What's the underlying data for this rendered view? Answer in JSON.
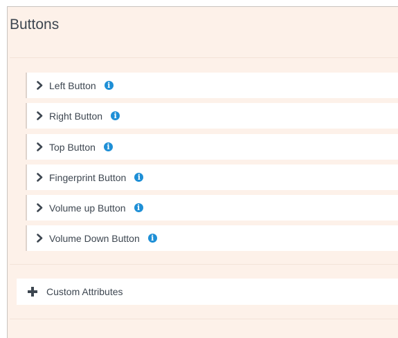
{
  "panel": {
    "title": "Buttons"
  },
  "accordion": {
    "items": [
      {
        "label": "Left Button",
        "icon": "info-icon"
      },
      {
        "label": "Right Button",
        "icon": "info-icon"
      },
      {
        "label": "Top Button",
        "icon": "info-icon"
      },
      {
        "label": "Fingerprint Button",
        "icon": "info-icon"
      },
      {
        "label": "Volume up Button",
        "icon": "info-icon"
      },
      {
        "label": "Volume Down Button",
        "icon": "info-icon"
      }
    ],
    "expand_icon": "chevron-right-icon",
    "info_glyph": "i"
  },
  "custom_attributes": {
    "label": "Custom Attributes",
    "icon": "plus-icon"
  },
  "colors": {
    "panel_background": "#fdf1e9",
    "info_icon": "#1e8fd6",
    "text": "#3d4650"
  }
}
